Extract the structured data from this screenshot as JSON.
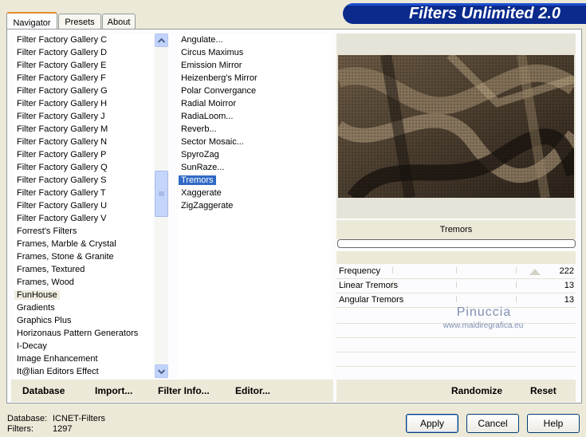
{
  "tabs": [
    {
      "label": "Navigator"
    },
    {
      "label": "Presets"
    },
    {
      "label": "About"
    }
  ],
  "brand": {
    "title": "Filters Unlimited 2.0"
  },
  "categories": {
    "items": [
      "Filter Factory Gallery C",
      "Filter Factory Gallery D",
      "Filter Factory Gallery E",
      "Filter Factory Gallery F",
      "Filter Factory Gallery G",
      "Filter Factory Gallery H",
      "Filter Factory Gallery J",
      "Filter Factory Gallery M",
      "Filter Factory Gallery N",
      "Filter Factory Gallery P",
      "Filter Factory Gallery Q",
      "Filter Factory Gallery S",
      "Filter Factory Gallery T",
      "Filter Factory Gallery U",
      "Filter Factory Gallery V",
      "Forrest's Filters",
      "Frames, Marble & Crystal",
      "Frames, Stone & Granite",
      "Frames, Textured",
      "Frames, Wood",
      "FunHouse",
      "Gradients",
      "Graphics Plus",
      "Horizonaus Pattern Generators",
      "I-Decay",
      "Image Enhancement",
      "It@lian Editors Effect"
    ],
    "selected": "FunHouse"
  },
  "filters": {
    "items": [
      "Angulate...",
      "Circus Maximus",
      "Emission Mirror",
      "Heizenberg's Mirror",
      "Polar Convergance",
      "Radial Moirror",
      "RadiaLoom...",
      "Reverb...",
      "Sector Mosaic...",
      "SpyroZag",
      "SunRaze...",
      "Tremors",
      "Xaggerate",
      "ZigZaggerate"
    ],
    "selected": "Tremors"
  },
  "toolbar": {
    "database_label": "Database",
    "import_label": "Import...",
    "filter_info_label": "Filter Info...",
    "editor_label": "Editor..."
  },
  "preview": {
    "filter_name": "Tremors",
    "progress": 0
  },
  "params": [
    {
      "label": "Frequency",
      "value": "222",
      "level": 0.87
    },
    {
      "label": "Linear Tremors",
      "value": "13",
      "level": 0.05
    },
    {
      "label": "Angular Tremors",
      "value": "13",
      "level": 0.05
    }
  ],
  "watermark": {
    "line1": "Pinuccia",
    "line2": "www.maidiregrafica.eu"
  },
  "actions": {
    "randomize_label": "Randomize",
    "reset_label": "Reset"
  },
  "status": {
    "database_label": "Database:",
    "database_value": "ICNET-Filters",
    "filters_label": "Filters:",
    "filters_value": "1297"
  },
  "buttons": {
    "apply_label": "Apply",
    "cancel_label": "Cancel",
    "help_label": "Help"
  },
  "colors": {
    "selection": "#316ac5",
    "banner": "#0a2a8c",
    "dialog": "#ece9d8"
  }
}
